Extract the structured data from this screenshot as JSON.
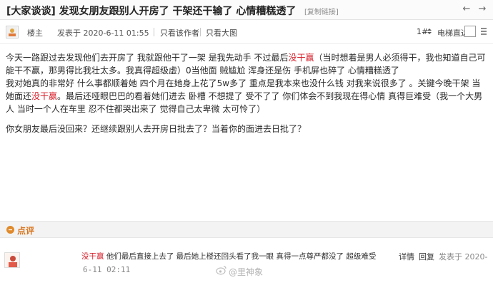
{
  "title": {
    "text": "[大家谈谈] 发现女朋友跟别人开房了 干架还干输了 心情糟糕透了",
    "copy_link": "[复制链接]"
  },
  "meta": {
    "role": "楼主",
    "post_time": "发表于 2020-6-11 01:55",
    "only_author": "只看该作者",
    "only_image": "只看大图",
    "floor_mark": "1#",
    "elevator_label": "电梯直达"
  },
  "post": {
    "para1": [
      {
        "t": "今天一路跟过去发现他们去开房了 我就跟他干了一架      是我先动手        不过最后",
        "hl": false
      },
      {
        "t": "没干赢",
        "hl": true
      },
      {
        "t": "（当时想着是男人必须得干，我也知道自己可能干不赢，那男得比我壮太多。我真得超级虚）0当他面 贼尴尬     浑身还是伤 手机屏也碎了       心情糟糕透了",
        "hl": false
      }
    ],
    "para2": [
      {
        "t": "我对她真的非常好 什么事都顺着她 四个月在她身上花了5w多了 重点是我本来也没什么钱 对我来说很多了 。关键今晚干架 当她面还",
        "hl": false
      },
      {
        "t": "没干赢",
        "hl": true
      },
      {
        "t": "。最后还哑眼巴巴的看着她们进去 卧槽 不想提了 受不了了          你们体会不到我现在得心情 真得巨难受（我一个大男人        当时一个人在车里 忍不住都哭出来了       觉得自己太卑微 太可怜了）",
        "hl": false
      }
    ],
    "para3": "你女朋友最后没回来？还继续跟别人去开房日批去了？当着你的面进去日批了？"
  },
  "comments": {
    "title": "点评",
    "item": {
      "name": "",
      "text_parts": [
        {
          "t": "没干赢",
          "hl": true
        },
        {
          "t": " 他们最后直接上去了 最后她上楼还回头看了我一眼 真得一点尊严都没了 超级难受",
          "hl": false
        }
      ],
      "detail": "详情",
      "reply": "回复",
      "time_prefix": "发表于 2020-",
      "time_rest": "6-11 02:11"
    }
  },
  "watermark": "@里神象",
  "colors": {
    "highlight": "#d6212c",
    "comment_title": "#d8741b"
  },
  "icons": [
    "author-icon",
    "arrow-left-icon",
    "arrow-right-icon",
    "elevator-icon",
    "go-button-icon",
    "comment-icon",
    "avatar"
  ]
}
